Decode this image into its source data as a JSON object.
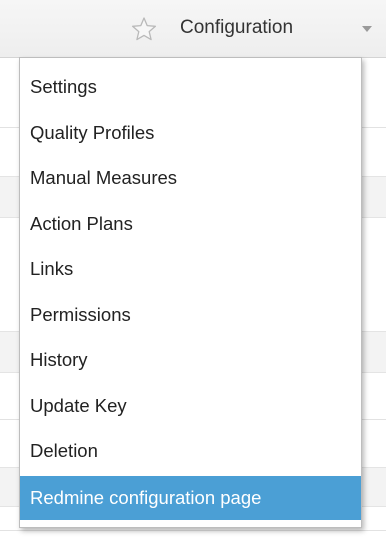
{
  "header": {
    "favourite_icon": "star-outline-icon",
    "menu_label": "Configuration",
    "dropdown_icon": "caret-down-icon"
  },
  "menu": {
    "items": [
      {
        "label": "Settings"
      },
      {
        "label": "Quality Profiles"
      },
      {
        "label": "Manual Measures"
      },
      {
        "label": "Action Plans"
      },
      {
        "label": "Links"
      },
      {
        "label": "Permissions"
      },
      {
        "label": "History"
      },
      {
        "label": "Update Key"
      },
      {
        "label": "Deletion"
      },
      {
        "label": "Redmine configuration page",
        "selected": true
      }
    ]
  },
  "colors": {
    "highlight": "#4b9fd5",
    "text": "#222222",
    "topbar": "#f2f2f2"
  }
}
